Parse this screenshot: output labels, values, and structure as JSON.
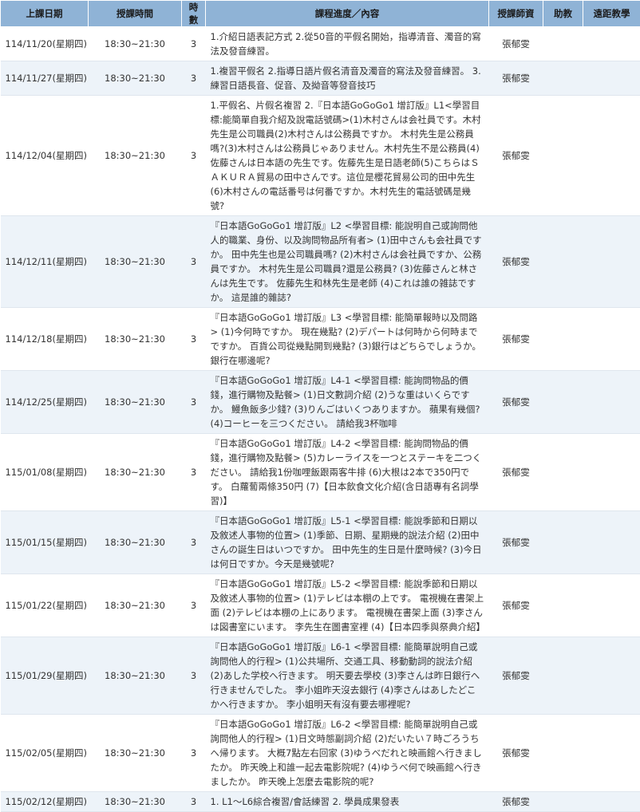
{
  "headers": {
    "date": "上課日期",
    "time": "授課時間",
    "hours": "時數",
    "content": "課程進度／內容",
    "teacher": "授課師資",
    "assistant": "助教",
    "remote": "遠距教學"
  },
  "rows": [
    {
      "date": "114/11/20(星期四)",
      "time": "18:30~21:30",
      "hours": "3",
      "content": "1.介紹日語表記方式 2.從50音的平假名開始，指導清音、濁音的寫法及發音練習。",
      "teacher": "張郁雯",
      "assistant": "",
      "remote": ""
    },
    {
      "date": "114/11/27(星期四)",
      "time": "18:30~21:30",
      "hours": "3",
      "content": "1.複習平假名 2.指導日語片假名清音及濁音的寫法及發音練習。 3.練習日語長音、促音、及拗音等發音技巧",
      "teacher": "張郁雯",
      "assistant": "",
      "remote": ""
    },
    {
      "date": "114/12/04(星期四)",
      "time": "18:30~21:30",
      "hours": "3",
      "content": "1.平假名、片假名複習 2.『日本語GoGoGo1 增訂版』L1<學習目標:能簡單自我介紹及說電話號碼>(1)木村さんは会社員です。木村先生是公司職員(2)木村さんは公務員ですか。 木村先生是公務員嗎?(3)木村さんは公務員じゃありません。木村先生不是公務員(4)佐藤さんは日本語の先生です。佐藤先生是日語老師(5)こちらはＳＡＫＵＲＡ貿易の田中さんです。這位是櫻花貿易公司的田中先生(6)木村さんの電話番号は何番ですか。木村先生的電話號碼是幾號?",
      "teacher": "張郁雯",
      "assistant": "",
      "remote": ""
    },
    {
      "date": "114/12/11(星期四)",
      "time": "18:30~21:30",
      "hours": "3",
      "content": "『日本語GoGoGo1 增訂版』L2 <學習目標: 能說明自己或詢問他人的職業、身份、以及詢問物品所有者> (1)田中さんも会社員ですか。 田中先生也是公司職員嗎? (2)木村さんは会社員ですか、公務員ですか。 木村先生是公司職員?還是公務員? (3)佐藤さんと林さんは先生です。 佐藤先生和林先生是老師 (4)これは誰の雑誌ですか。 這是誰的雜誌?",
      "teacher": "張郁雯",
      "assistant": "",
      "remote": ""
    },
    {
      "date": "114/12/18(星期四)",
      "time": "18:30~21:30",
      "hours": "3",
      "content": "『日本語GoGoGo1 增訂版』L3 <學習目標: 能簡單報時以及問路> (1)今何時ですか。 現在幾點? (2)デパートは何時から何時までですか。 百貨公司從幾點開到幾點? (3)銀行はどちらでしょうか。銀行在哪邊呢?",
      "teacher": "張郁雯",
      "assistant": "",
      "remote": ""
    },
    {
      "date": "114/12/25(星期四)",
      "time": "18:30~21:30",
      "hours": "3",
      "content": "『日本語GoGoGo1 增訂版』L4-1 <學習目標: 能詢問物品的價錢，進行購物及點餐> (1)日文數詞介紹 (2)うな重はいくらですか。 鰻魚飯多少錢? (3)りんごはいくつありますか。 蘋果有幾個? (4)コーヒーを三つください。 請給我3杯咖啡",
      "teacher": "張郁雯",
      "assistant": "",
      "remote": ""
    },
    {
      "date": "115/01/08(星期四)",
      "time": "18:30~21:30",
      "hours": "3",
      "content": "『日本語GoGoGo1 增訂版』L4-2 <學習目標: 能詢問物品的價錢，進行購物及點餐> (5)カレーライスを一つとステーキを二つください。 請給我1份咖哩飯跟兩客牛排 (6)大根は2本で350円です。 白蘿蔔兩條350円 (7)【日本飲食文化介紹(含日語專有名詞學習)】",
      "teacher": "張郁雯",
      "assistant": "",
      "remote": ""
    },
    {
      "date": "115/01/15(星期四)",
      "time": "18:30~21:30",
      "hours": "3",
      "content": "『日本語GoGoGo1 增訂版』L5-1 <學習目標: 能說季節和日期以及敘述人事物的位置> (1)季節、日期、星期幾的說法介紹 (2)田中さんの誕生日はいつですか。 田中先生的生日是什麼時候? (3)今日は何日ですか。今天是幾號呢?",
      "teacher": "張郁雯",
      "assistant": "",
      "remote": ""
    },
    {
      "date": "115/01/22(星期四)",
      "time": "18:30~21:30",
      "hours": "3",
      "content": "『日本語GoGoGo1 增訂版』L5-2 <學習目標: 能說季節和日期以及敘述人事物的位置> (1)テレビは本棚の上です。 電視機在書架上面 (2)テレビは本棚の上にあります。 電視機在書架上面 (3)李さんは図書室にいます。 李先生在圖書室裡 (4)【日本四季與祭典介紹】",
      "teacher": "張郁雯",
      "assistant": "",
      "remote": ""
    },
    {
      "date": "115/01/29(星期四)",
      "time": "18:30~21:30",
      "hours": "3",
      "content": "『日本語GoGoGo1 增訂版』L6-1 <學習目標: 能簡單說明自己或詢問他人的行程> (1)公共場所、交通工具、移動動詞的說法介紹 (2)あした学校へ行きます。 明天要去學校 (3)李さんは昨日銀行へ行きませんでした。 李小姐昨天沒去銀行 (4)李さんはあしたどこかへ行きますか。 李小姐明天有沒有要去哪裡呢?",
      "teacher": "張郁雯",
      "assistant": "",
      "remote": ""
    },
    {
      "date": "115/02/05(星期四)",
      "time": "18:30~21:30",
      "hours": "3",
      "content": "『日本語GoGoGo1 增訂版』L6-2 <學習目標: 能簡單說明自己或詢問他人的行程> (1)日文時態副詞介紹 (2)だいたい７時ごろうちへ帰ります。 大概7點左右回家 (3)ゆうべだれと映画館へ行きましたか。 昨天晚上和誰一起去電影院呢? (4)ゆうべ何で映画館へ行きましたか。 昨天晚上怎麼去電影院的呢?",
      "teacher": "張郁雯",
      "assistant": "",
      "remote": ""
    },
    {
      "date": "115/02/12(星期四)",
      "time": "18:30~21:30",
      "hours": "3",
      "content": "1. L1～L6綜合複習/會話練習 2. 學員成果發表",
      "teacher": "張郁雯",
      "assistant": "",
      "remote": ""
    }
  ]
}
